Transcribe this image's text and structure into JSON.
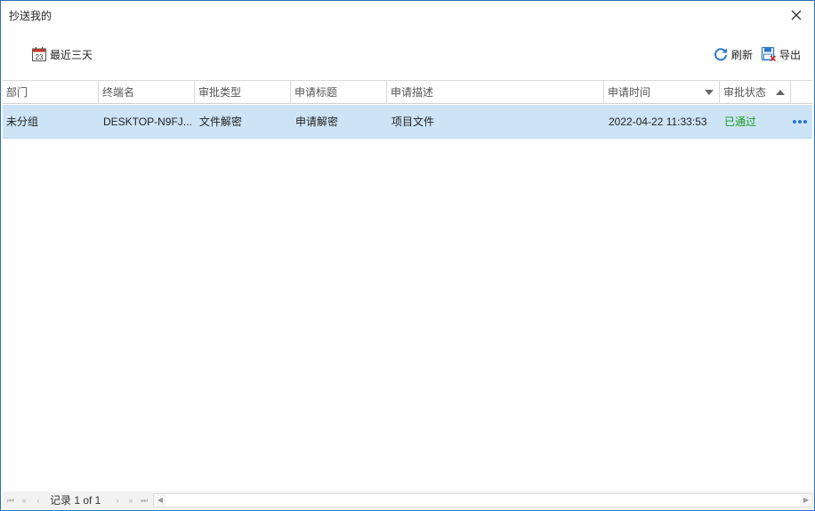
{
  "window": {
    "title": "抄送我的"
  },
  "toolbar": {
    "recent_label": "最近三天",
    "refresh_label": "刷新",
    "export_label": "导出",
    "calendar_day": "23"
  },
  "table": {
    "columns": [
      "部门",
      "终端名",
      "审批类型",
      "申请标题",
      "申请描述",
      "申请时间",
      "审批状态"
    ],
    "rows": [
      {
        "dept": "未分组",
        "terminal": "DESKTOP-N9FJ...",
        "type": "文件解密",
        "title": "申请解密",
        "desc": "项目文件",
        "time": "2022-04-22 11:33:53",
        "status": "已通过"
      }
    ]
  },
  "pager": {
    "record_text": "记录 1 of 1"
  },
  "colors": {
    "accent": "#2b78c8",
    "selected_row": "#cde4f7",
    "status_ok": "#1a9a1a"
  }
}
